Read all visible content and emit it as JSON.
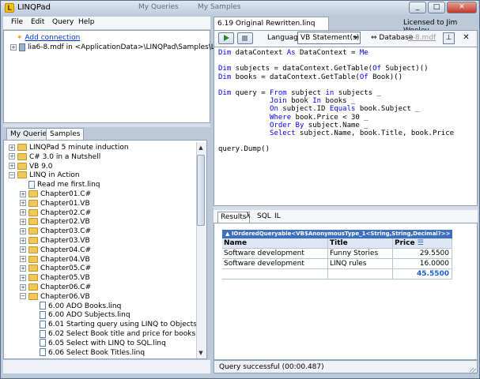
{
  "window": {
    "title": "LINQPad",
    "background_titles": [
      "My Queries",
      "My Samples"
    ],
    "licensed_to": "Licensed to Jim Wooley"
  },
  "menu": [
    "File",
    "Edit",
    "Query",
    "Help"
  ],
  "connections": {
    "add_connection": "Add connection",
    "items": [
      "lia6-8.mdf in <ApplicationData>\\LINQPad\\Samples\\LINQ in Ac"
    ]
  },
  "left_tabs": [
    "My Queries",
    "Samples"
  ],
  "samples_tree": [
    {
      "label": "LINQPad 5 minute induction",
      "type": "folder",
      "depth": 0,
      "expander": "+"
    },
    {
      "label": "C# 3.0 in a Nutshell",
      "type": "folder",
      "depth": 0,
      "expander": "+"
    },
    {
      "label": "VB 9.0",
      "type": "folder",
      "depth": 0,
      "expander": "+"
    },
    {
      "label": "LINQ in Action",
      "type": "folder-open",
      "depth": 0,
      "expander": "−"
    },
    {
      "label": "Read me first.linq",
      "type": "file",
      "depth": 1,
      "expander": ""
    },
    {
      "label": "Chapter01.C#",
      "type": "folder",
      "depth": 1,
      "expander": "+"
    },
    {
      "label": "Chapter01.VB",
      "type": "folder",
      "depth": 1,
      "expander": "+"
    },
    {
      "label": "Chapter02.C#",
      "type": "folder",
      "depth": 1,
      "expander": "+"
    },
    {
      "label": "Chapter02.VB",
      "type": "folder",
      "depth": 1,
      "expander": "+"
    },
    {
      "label": "Chapter03.C#",
      "type": "folder",
      "depth": 1,
      "expander": "+"
    },
    {
      "label": "Chapter03.VB",
      "type": "folder",
      "depth": 1,
      "expander": "+"
    },
    {
      "label": "Chapter04.C#",
      "type": "folder",
      "depth": 1,
      "expander": "+"
    },
    {
      "label": "Chapter04.VB",
      "type": "folder",
      "depth": 1,
      "expander": "+"
    },
    {
      "label": "Chapter05.C#",
      "type": "folder",
      "depth": 1,
      "expander": "+"
    },
    {
      "label": "Chapter05.VB",
      "type": "folder",
      "depth": 1,
      "expander": "+"
    },
    {
      "label": "Chapter06.C#",
      "type": "folder",
      "depth": 1,
      "expander": "+"
    },
    {
      "label": "Chapter06.VB",
      "type": "folder-open",
      "depth": 1,
      "expander": "−"
    },
    {
      "label": "6.00 ADO Books.linq",
      "type": "file",
      "depth": 2,
      "expander": ""
    },
    {
      "label": "6.00 ADO Subjects.linq",
      "type": "file",
      "depth": 2,
      "expander": ""
    },
    {
      "label": "6.01 Starting query using LINQ to Objects.linq",
      "type": "file",
      "depth": 2,
      "expander": ""
    },
    {
      "label": "6.02 Select Book title and price for books less than",
      "type": "file",
      "depth": 2,
      "expander": ""
    },
    {
      "label": "6.05 Select with LINQ to SQL.linq",
      "type": "file",
      "depth": 2,
      "expander": ""
    },
    {
      "label": "6.06 Select Book Titles.linq",
      "type": "file",
      "depth": 2,
      "expander": ""
    }
  ],
  "query_tab": "6.19 Original Rewritten.linq",
  "toolbar": {
    "language_label": "Language",
    "language_value": "VB Statement(s)",
    "database_label": "Database",
    "database_value": "6-8.mdf"
  },
  "code_lines": [
    [
      {
        "t": "Dim",
        "k": 1
      },
      {
        "t": " dataContext "
      },
      {
        "t": "As",
        "k": 1
      },
      {
        "t": " DataContext = "
      },
      {
        "t": "Me",
        "k": 1
      }
    ],
    [],
    [
      {
        "t": "Dim",
        "k": 1
      },
      {
        "t": " subjects = dataContext.GetTable("
      },
      {
        "t": "Of",
        "k": 1
      },
      {
        "t": " Subject)()"
      }
    ],
    [
      {
        "t": "Dim",
        "k": 1
      },
      {
        "t": " books = dataContext.GetTable("
      },
      {
        "t": "Of",
        "k": 1
      },
      {
        "t": " Book)()"
      }
    ],
    [],
    [
      {
        "t": "Dim",
        "k": 1
      },
      {
        "t": " query = "
      },
      {
        "t": "From",
        "k": 1
      },
      {
        "t": " subject "
      },
      {
        "t": "in",
        "k": 1
      },
      {
        "t": " subjects _"
      }
    ],
    [
      {
        "t": "            "
      },
      {
        "t": "Join",
        "k": 1
      },
      {
        "t": " book "
      },
      {
        "t": "In",
        "k": 1
      },
      {
        "t": " books _"
      }
    ],
    [
      {
        "t": "            "
      },
      {
        "t": "On",
        "k": 1
      },
      {
        "t": " subject.ID "
      },
      {
        "t": "Equals",
        "k": 1
      },
      {
        "t": " book.Subject _"
      }
    ],
    [
      {
        "t": "            "
      },
      {
        "t": "Where",
        "k": 1
      },
      {
        "t": " book.Price < 30 _"
      }
    ],
    [
      {
        "t": "            "
      },
      {
        "t": "Order By",
        "k": 1
      },
      {
        "t": " subject.Name _"
      }
    ],
    [
      {
        "t": "            "
      },
      {
        "t": "Select",
        "k": 1
      },
      {
        "t": " subject.Name, book.Title, book.Price"
      }
    ],
    [],
    [
      {
        "t": "query.Dump()"
      }
    ]
  ],
  "result_tabs": [
    "Results",
    "λ",
    "SQL",
    "IL"
  ],
  "results": {
    "header": "IOrderedQueryable<VB$AnonymousType_1<String,String,Decimal?>> (2 items)",
    "columns": [
      "Name",
      "Title",
      "Price"
    ],
    "rows": [
      [
        "Software development",
        "Funny Stories",
        "29.5500"
      ],
      [
        "Software development",
        "LINQ rules",
        "16.0000"
      ]
    ],
    "total": "45.5500"
  },
  "status": "Query successful  (00:00.487)"
}
